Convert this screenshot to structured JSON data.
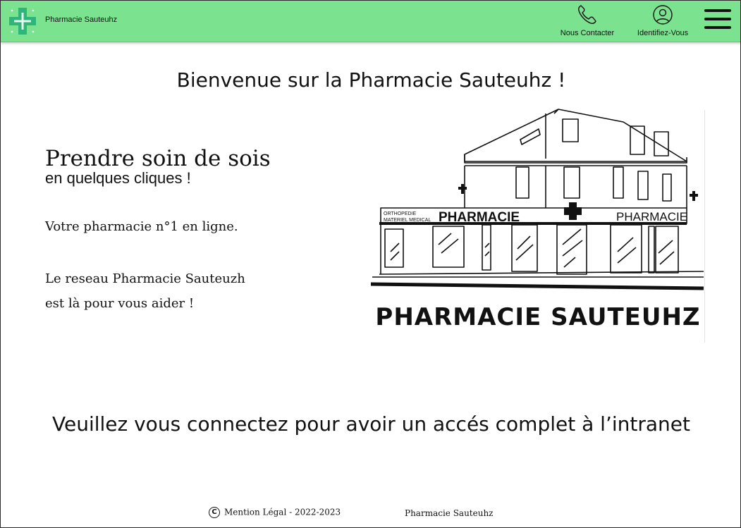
{
  "header": {
    "brand": "Pharmacie Sauteuhz",
    "logo_icon": "medical-cross-icon",
    "contact_label": "Nous Contacter",
    "contact_icon": "phone-icon",
    "login_label": "Identifiez-Vous",
    "login_icon": "user-icon",
    "menu_icon": "hamburger-menu-icon"
  },
  "main": {
    "welcome": "Bienvenue sur la Pharmacie Sauteuhz !",
    "headline": "Prendre soin de sois",
    "subline": "en quelques cliques !",
    "tagline": "Votre pharmacie n°1 en ligne.",
    "network_line1": "Le reseau Pharmacie Sauteuzh",
    "network_line2": "est là pour vous aider !",
    "illustration": {
      "sign_left": "ORTHOPEDIE",
      "sign_left2": "MATERIEL MEDICAL",
      "sign_main": "PHARMACIE",
      "sign_right": "PHARMACIE",
      "caption": "PHARMACIE SAUTEUHZ"
    },
    "cta": "Veuillez vous connectez pour avoir un accés complet à l’intranet"
  },
  "footer": {
    "copyright_symbol": "C",
    "legal": "Mention Légal - 2022-2023",
    "brand": "Pharmacie Sauteuhz"
  },
  "colors": {
    "header_bg": "#7be28f",
    "logo_green": "#2db57a",
    "text": "#111111"
  }
}
